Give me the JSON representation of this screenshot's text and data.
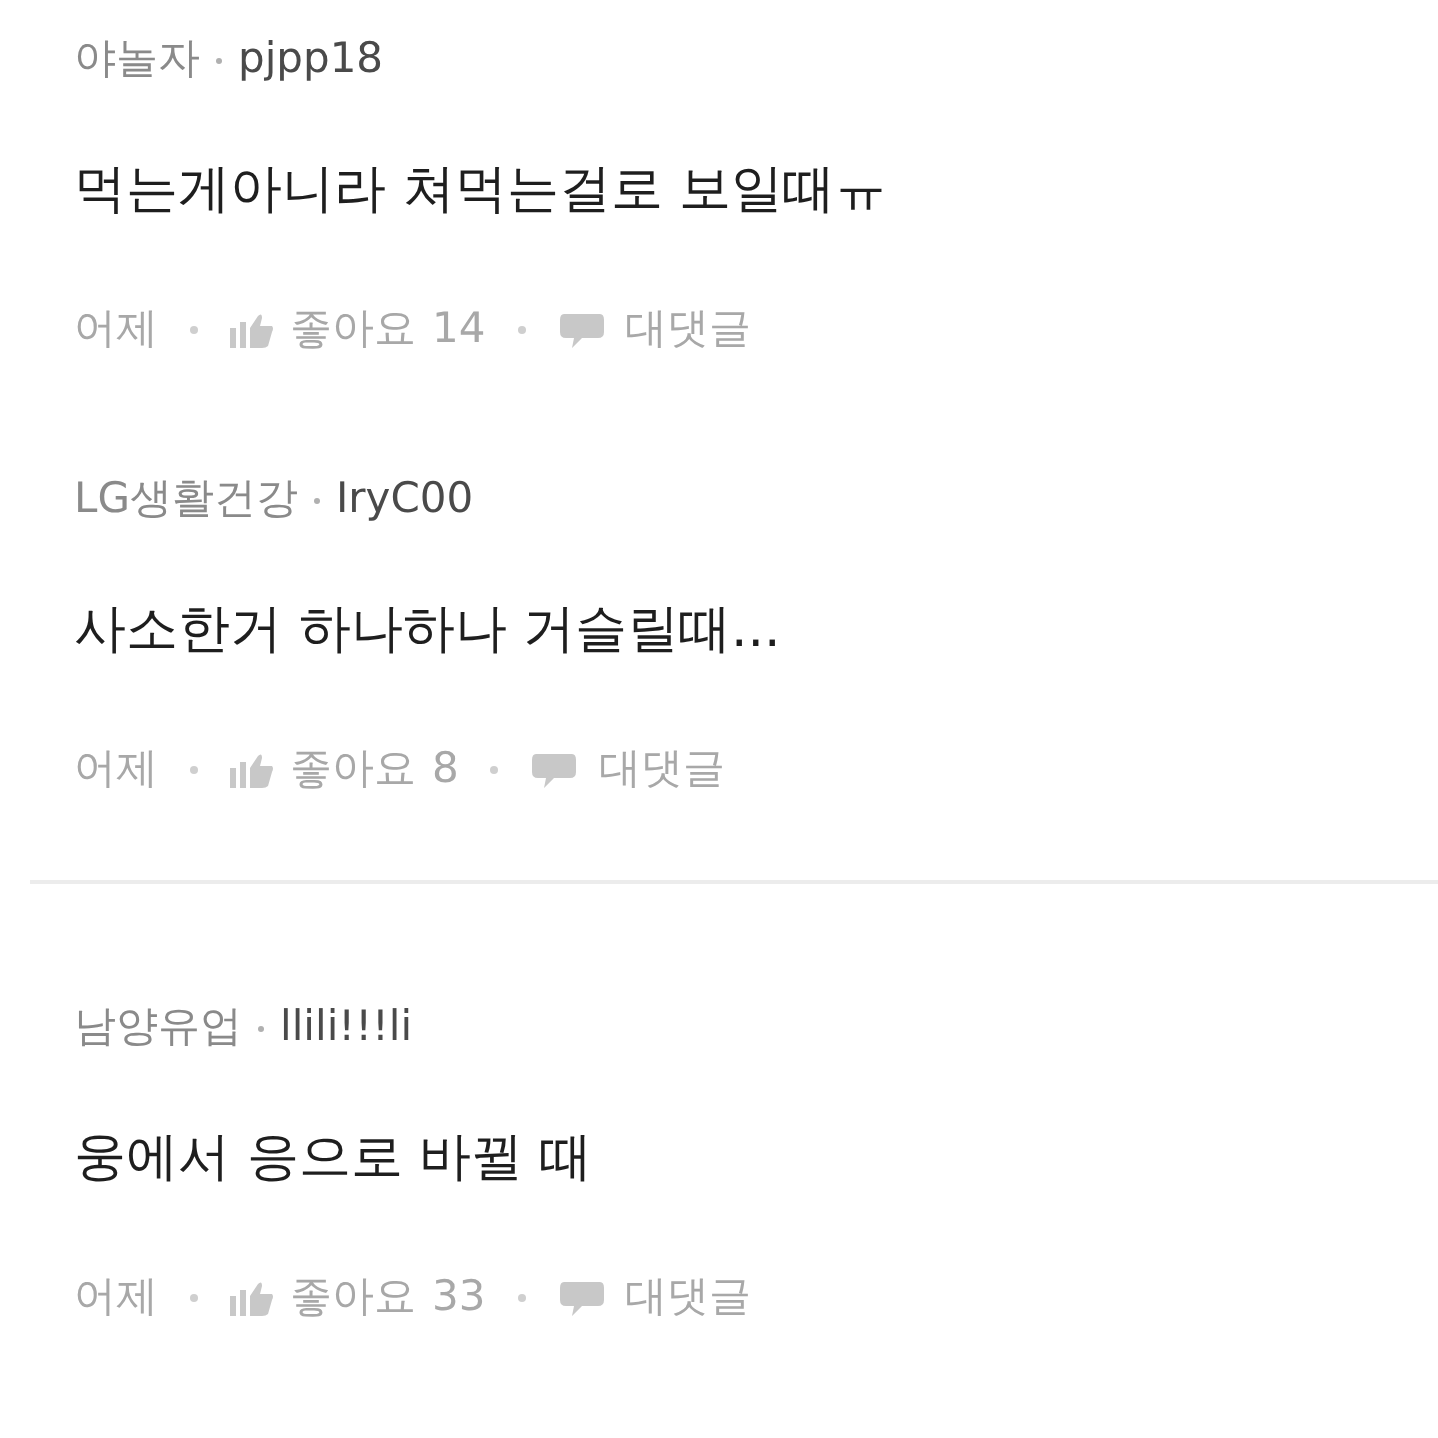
{
  "groups": [
    {
      "comments": [
        {
          "author": "야놀자",
          "username": "pjpp18",
          "body": "먹는게아니라 쳐먹는걸로 보일때ㅠ",
          "time": "어제",
          "like_label": "좋아요",
          "likes": "14",
          "reply_label": "대댓글"
        },
        {
          "author": "LG생활건강",
          "username": "IryC00",
          "body": "사소한거 하나하나 거슬릴때...",
          "time": "어제",
          "like_label": "좋아요",
          "likes": "8",
          "reply_label": "대댓글"
        }
      ]
    },
    {
      "comments": [
        {
          "author": "남양유업",
          "username": "llili!!!li",
          "body": "웅에서 응으로 바뀔 때",
          "time": "어제",
          "like_label": "좋아요",
          "likes": "33",
          "reply_label": "대댓글"
        }
      ]
    }
  ]
}
